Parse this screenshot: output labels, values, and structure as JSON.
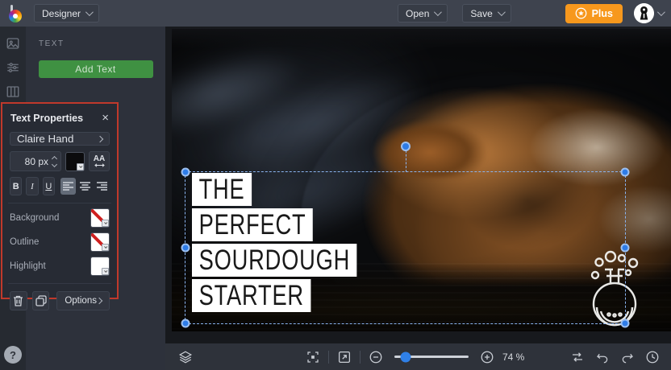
{
  "topbar": {
    "app_menu_label": "Designer",
    "open_label": "Open",
    "save_label": "Save",
    "plus_label": "Plus"
  },
  "left_panel": {
    "title": "TEXT",
    "add_text_label": "Add Text"
  },
  "text_properties": {
    "title": "Text Properties",
    "close_icon": "×",
    "font_name": "Claire Hand",
    "font_size": "80 px",
    "letter_spacing_label": "AA",
    "bold_label": "B",
    "italic_label": "I",
    "underline_label": "U",
    "alignment_selected": "left",
    "color_rows": [
      {
        "label": "Background",
        "swatch": "none"
      },
      {
        "label": "Outline",
        "swatch": "none"
      },
      {
        "label": "Highlight",
        "swatch": "white"
      }
    ],
    "options_label": "Options"
  },
  "canvas": {
    "text_lines": {
      "0": "THE",
      "1": "PERFECT",
      "2": "SOURDOUGH",
      "3": "STARTER"
    },
    "selection": {
      "handles": 6,
      "rotation_handle": true
    }
  },
  "bottombar": {
    "zoom_value": "74 %"
  },
  "help_label": "?",
  "colors": {
    "accent_green": "#3f9142",
    "accent_orange": "#f7981d",
    "accent_blue": "#2f80e8",
    "annotation_red": "#c0392b",
    "topbar_bg": "#3e434e",
    "panel_bg": "#2d313b",
    "props_bg": "#272b34"
  }
}
